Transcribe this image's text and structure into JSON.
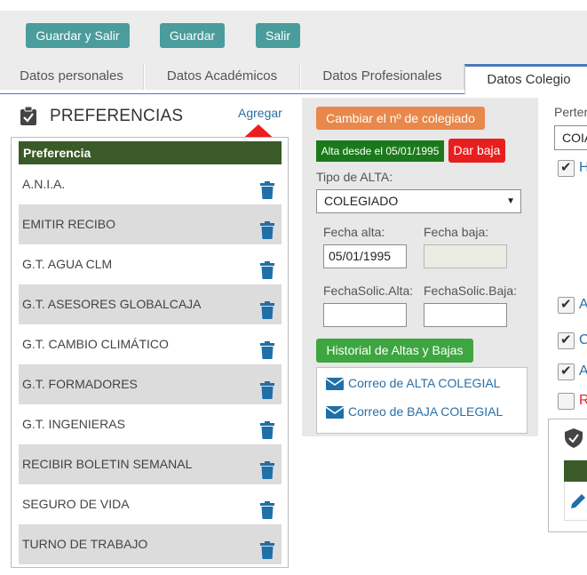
{
  "toolbar": {
    "save_exit_label": "Guardar y Salir",
    "save_label": "Guardar",
    "exit_label": "Salir"
  },
  "tabs": [
    {
      "label": "Datos personales"
    },
    {
      "label": "Datos Académicos"
    },
    {
      "label": "Datos Profesionales"
    },
    {
      "label": "Datos Colegio"
    }
  ],
  "preferences": {
    "title": "PREFERENCIAS",
    "add_label": "Agregar",
    "column_header": "Preferencia",
    "items": [
      {
        "label": "A.N.I.A."
      },
      {
        "label": "EMITIR RECIBO"
      },
      {
        "label": "G.T. AGUA CLM"
      },
      {
        "label": "G.T. ASESORES GLOBALCAJA"
      },
      {
        "label": "G.T. CAMBIO CLIMÁTICO"
      },
      {
        "label": "G.T. FORMADORES"
      },
      {
        "label": "G.T. INGENIERAS"
      },
      {
        "label": "RECIBIR BOLETIN SEMANAL"
      },
      {
        "label": "SEGURO DE VIDA"
      },
      {
        "label": "TURNO DE TRABAJO"
      }
    ]
  },
  "colegio": {
    "change_number_label": "Cambiar el nº de colegiado",
    "status_badge": "Alta desde el 05/01/1995",
    "dar_baja_label": "Dar baja",
    "tipo_alta_label": "Tipo de ALTA:",
    "tipo_alta_value": "COLEGIADO",
    "fecha_alta_label": "Fecha alta:",
    "fecha_alta_value": "05/01/1995",
    "fecha_baja_label": "Fecha baja:",
    "fecha_baja_value": "",
    "fecha_solic_alta_label": "FechaSolic.Alta:",
    "fecha_solic_alta_value": "",
    "fecha_solic_baja_label": "FechaSolic.Baja:",
    "fecha_solic_baja_value": "",
    "historial_label": "Historial de Altas y Bajas",
    "mail_alta_label": "Correo de ALTA COLEGIAL",
    "mail_baja_label": "Correo de BAJA COLEGIAL"
  },
  "right": {
    "label_partial": "Perter",
    "select_partial": "COIA",
    "checks": [
      {
        "text": "H",
        "checked": true,
        "color": "#2a6fa6"
      },
      {
        "text": "A",
        "checked": true,
        "color": "#2a6fa6"
      },
      {
        "text": "C",
        "checked": true,
        "color": "#2a6fa6"
      },
      {
        "text": "A",
        "checked": true,
        "color": "#2a6fa6"
      },
      {
        "text": "R",
        "checked": false,
        "color": "#e81f1f"
      }
    ]
  },
  "colors": {
    "toolbar_button": "#4b9c9c",
    "table_header": "#3a5a28",
    "orange_button": "#e8884a",
    "green_button": "#3ea640",
    "danger": "#e81f1f",
    "link": "#2a6fa6"
  }
}
